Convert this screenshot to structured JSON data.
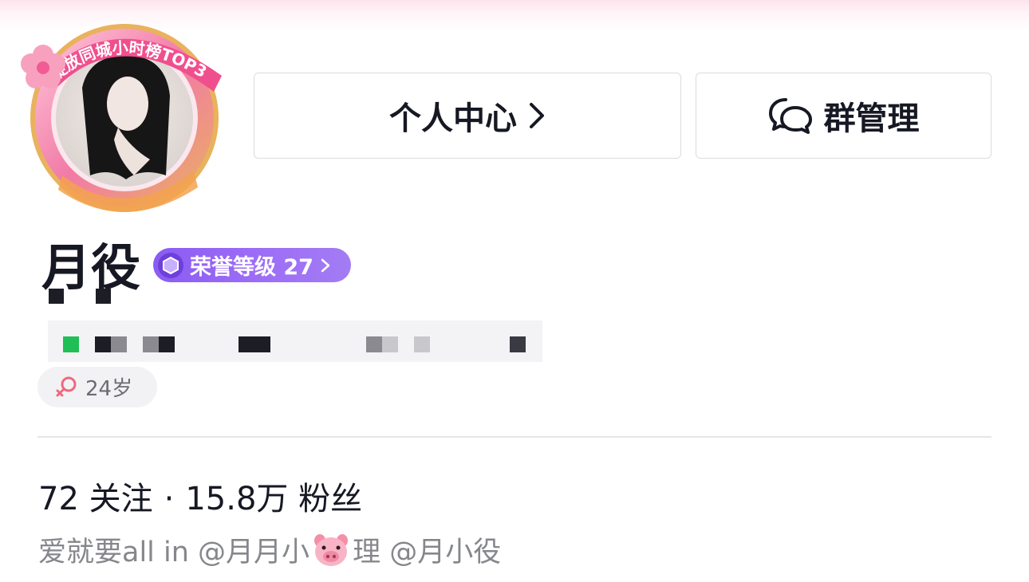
{
  "avatar": {
    "frame_banner": "绽放同城小时榜TOP3",
    "colors": {
      "ring": "#f5a8c4",
      "gold": "#e9b25d",
      "hair": "#141414"
    }
  },
  "actions": {
    "profile_label": "个人中心",
    "group_label": "群管理"
  },
  "user": {
    "name": "月役",
    "honor_badge": "荣誉等级 27",
    "age": "24岁"
  },
  "stats": {
    "following_count": "72",
    "following_label": "关注",
    "separator": "·",
    "followers_count": "15.8万",
    "followers_label": "粉丝"
  },
  "bio": {
    "part1": "爱就要all in @月月小",
    "emoji": "pig-face-emoji",
    "part2": "理 @月小役"
  },
  "colors": {
    "honor_bg": "#9466f4",
    "text_primary": "#161823",
    "text_secondary": "#86878c",
    "female_icon": "#f0687e"
  }
}
